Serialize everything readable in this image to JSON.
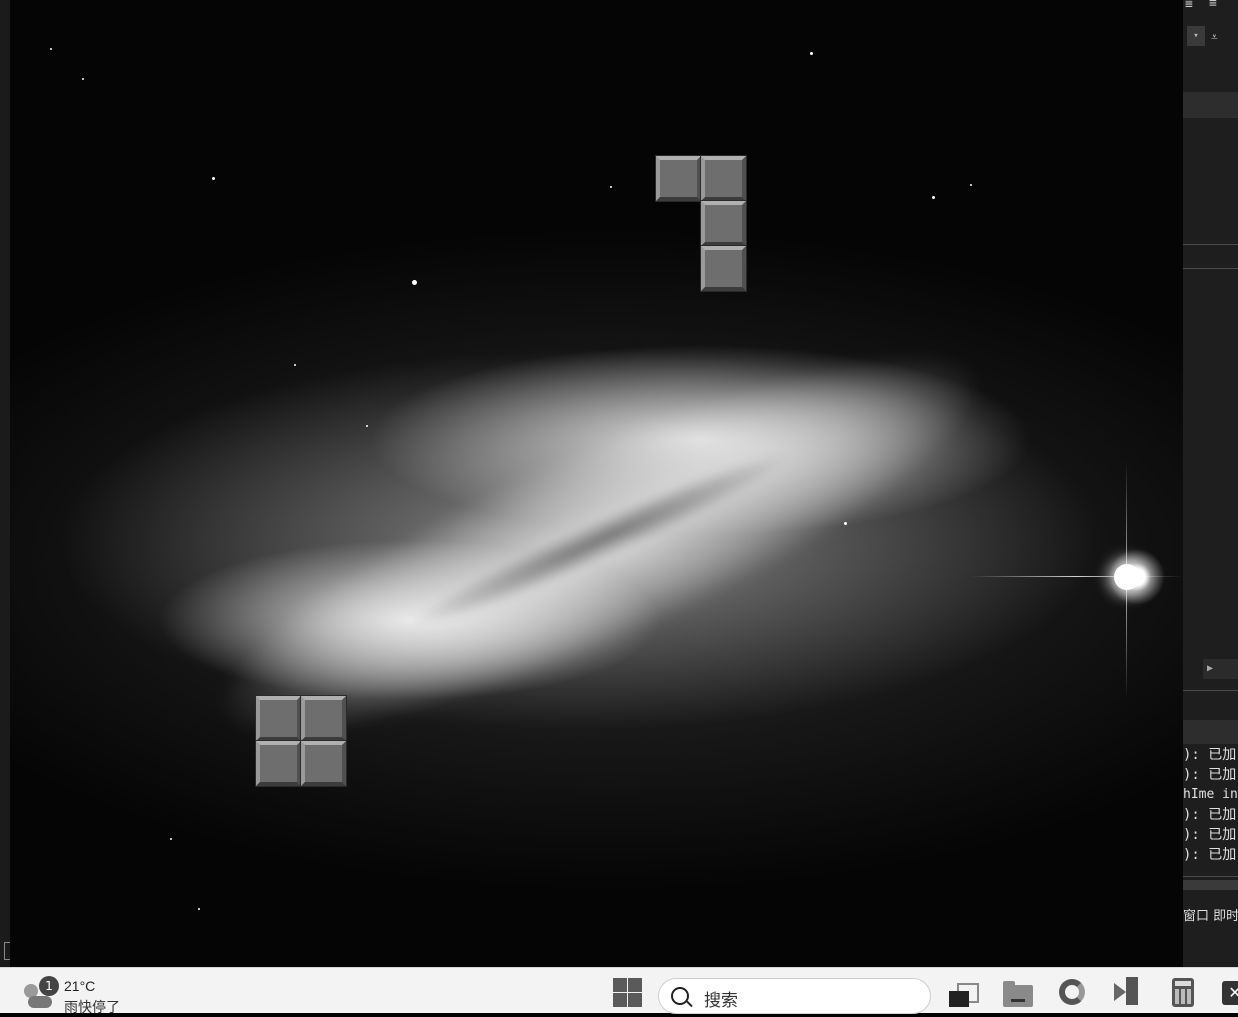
{
  "game": {
    "pieces": [
      {
        "name": "J-piece",
        "blocks": 4
      },
      {
        "name": "O-piece",
        "blocks": 4
      }
    ]
  },
  "ide": {
    "output_lines": [
      "): 已加",
      "): 已加",
      "hIme in",
      "): 已加",
      "): 已加",
      "): 已加"
    ],
    "bottom_tabs": "窗口  即时"
  },
  "taskbar": {
    "weather": {
      "temperature": "21°C",
      "description": "雨快停了",
      "badge": "1"
    },
    "search": {
      "placeholder": "搜索"
    },
    "icons": [
      "windows-start-icon",
      "search-icon",
      "task-view-icon",
      "file-explorer-icon",
      "edge-icon",
      "visual-studio-icon",
      "calculator-icon",
      "app-icon"
    ]
  },
  "colors": {
    "taskbar_bg": "#f3f3f3",
    "block_fill": "#6e6e6e",
    "ide_bg": "#1e1e1e"
  }
}
